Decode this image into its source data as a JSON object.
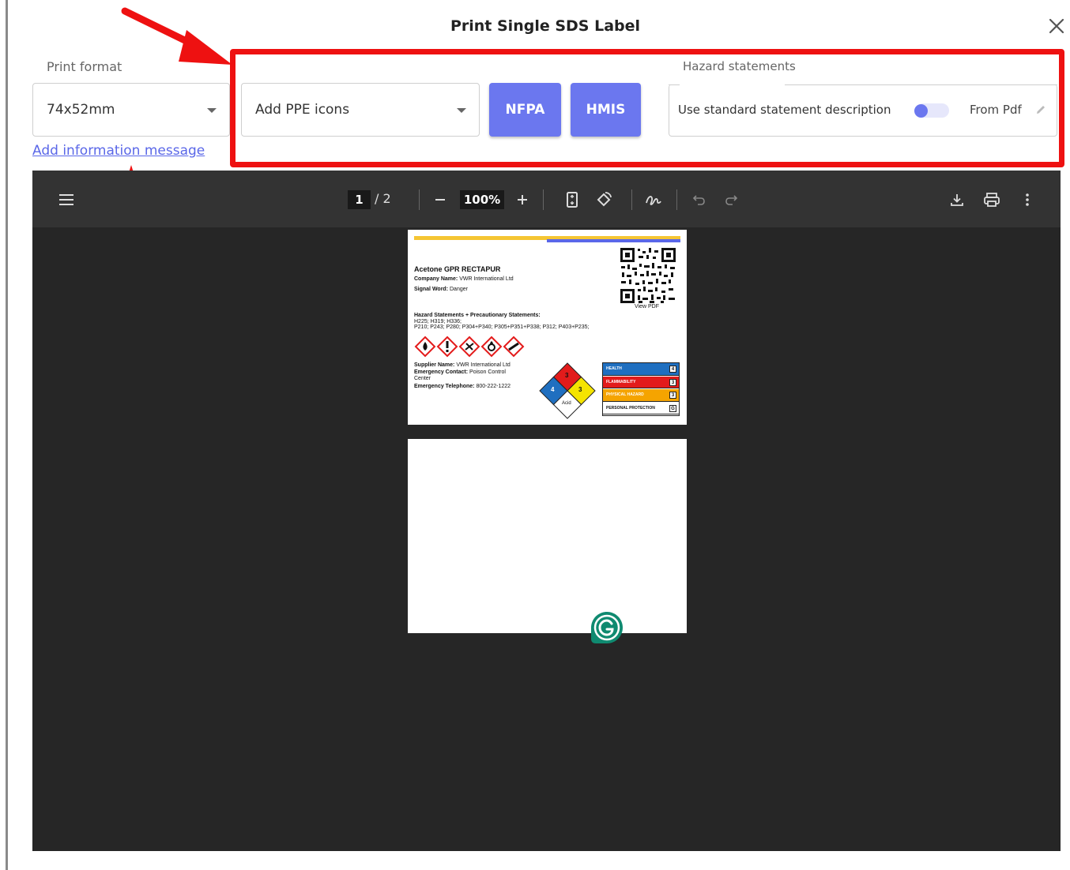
{
  "dialog": {
    "title": "Print Single SDS Label",
    "close_icon": "close-icon"
  },
  "print_format": {
    "label": "Print format",
    "value": "74x52mm"
  },
  "info_link": "Add information message",
  "ppe": {
    "value": "Add PPE icons"
  },
  "buttons": {
    "nfpa": "NFPA",
    "hmis": "HMIS"
  },
  "hazard_statements": {
    "label": "Hazard statements",
    "toggle_left": "Use standard statement description",
    "toggle_right": "From Pdf",
    "toggle_on": false
  },
  "viewer": {
    "page_current": "1",
    "page_total": "/ 2",
    "zoom": "100%",
    "icons": [
      "menu-icon",
      "zoom-out-icon",
      "zoom-in-icon",
      "fit-page-icon",
      "rotate-icon",
      "annotate-icon",
      "undo-icon",
      "redo-icon",
      "download-icon",
      "print-icon",
      "more-icon"
    ]
  },
  "label_doc": {
    "product": "Acetone GPR RECTAPUR",
    "company_key": "Company Name:",
    "company_val": "VWR International Ltd",
    "signal_key": "Signal Word:",
    "signal_val": "Danger",
    "view_pdf": "View PDF",
    "statements_title": "Hazard Statements + Precautionary Statements:",
    "statements_line1": "H225; H319; H336;",
    "statements_line2": "P210; P243; P280; P304+P340; P305+P351+P338; P312; P403+P235;",
    "supplier_key": "Supplier Name:",
    "supplier_val": "VWR International Ltd",
    "emergency_key": "Emergency Contact:",
    "emergency_val": "Poison Control",
    "emergency_val2": "Center",
    "phone_key": "Emergency Telephone:",
    "phone_val": "800-222-1222",
    "nfpa_top": "3",
    "nfpa_left": "4",
    "nfpa_right": "3",
    "nfpa_bottom": "Acid",
    "hmis_rows": [
      {
        "label": "HEALTH",
        "value": "4",
        "color": "#1f6fc0"
      },
      {
        "label": "FLAMMABILITY",
        "value": "3",
        "color": "#e21b1b"
      },
      {
        "label": "PHYSICAL HAZARD",
        "value": "3",
        "color": "#f5a400"
      },
      {
        "label": "PERSONAL PROTECTION",
        "value": "G",
        "color": "#ffffff"
      }
    ]
  },
  "colors": {
    "accent": "#6b77ef",
    "annotation_red": "#ee1111",
    "link": "#5a67e8"
  }
}
